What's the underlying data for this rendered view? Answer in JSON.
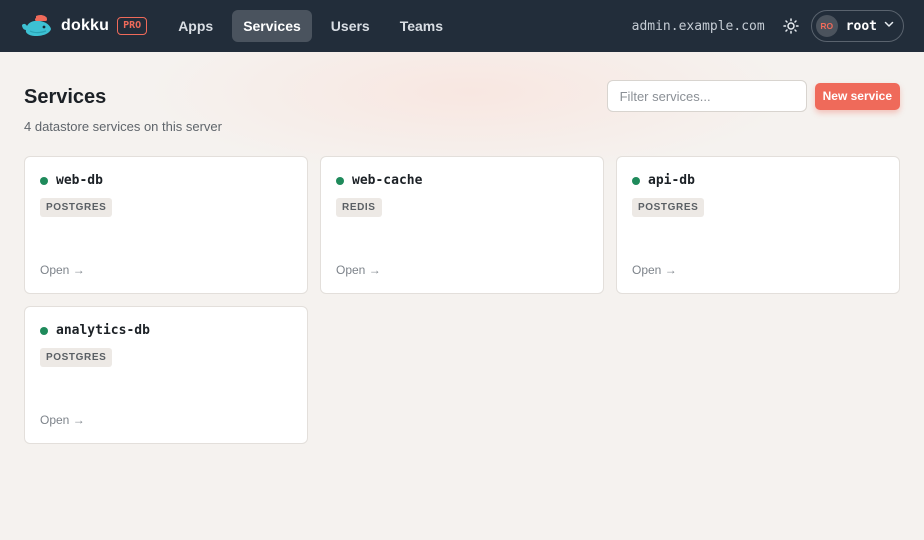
{
  "brand": {
    "name": "dokku",
    "badge": "PRO"
  },
  "nav": {
    "items": [
      {
        "label": "Apps",
        "active": false
      },
      {
        "label": "Services",
        "active": true
      },
      {
        "label": "Users",
        "active": false
      },
      {
        "label": "Teams",
        "active": false
      }
    ]
  },
  "topbar": {
    "host": "admin.example.com",
    "theme_icon": "sun-icon",
    "user": {
      "initials": "RO",
      "name": "root"
    }
  },
  "page": {
    "title": "Services",
    "subtitle": "4 datastore services on this server",
    "filter_placeholder": "Filter services...",
    "new_button": "New service"
  },
  "services": [
    {
      "name": "web-db",
      "type": "POSTGRES",
      "status": "running",
      "link": "Open →"
    },
    {
      "name": "web-cache",
      "type": "REDIS",
      "status": "running",
      "link": "Open →"
    },
    {
      "name": "api-db",
      "type": "POSTGRES",
      "status": "running",
      "link": "Open →"
    },
    {
      "name": "analytics-db",
      "type": "POSTGRES",
      "status": "running",
      "link": "Open →"
    }
  ],
  "colors": {
    "accent": "#ef6a5a",
    "topbar": "#222d3a",
    "status_running": "#1f8a5b"
  }
}
